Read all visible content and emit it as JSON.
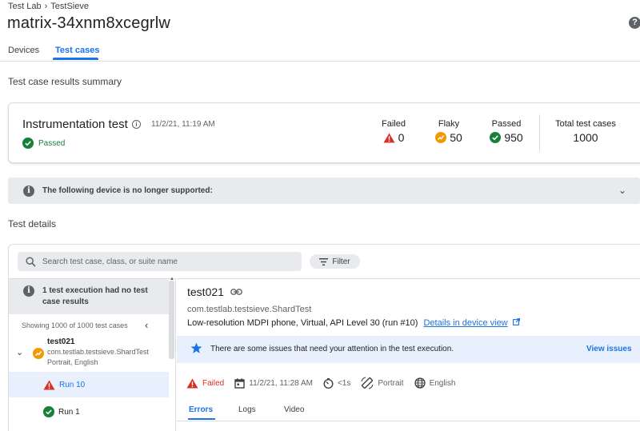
{
  "breadcrumb": {
    "root": "Test Lab",
    "separator": "›",
    "current": "TestSieve"
  },
  "page_title": "matrix-34xnm8xcegrlw",
  "help_icon": "help-circle-icon",
  "tabs": [
    {
      "label": "Devices",
      "active": false
    },
    {
      "label": "Test cases",
      "active": true
    }
  ],
  "summary": {
    "section_title": "Test case results summary",
    "test_name": "Instrumentation test",
    "datetime": "11/2/21, 11:19 AM",
    "status": "Passed",
    "stats": {
      "failed": {
        "label": "Failed",
        "value": "0",
        "icon": "warning-triangle-icon"
      },
      "flaky": {
        "label": "Flaky",
        "value": "50",
        "icon": "flaky-icon"
      },
      "passed": {
        "label": "Passed",
        "value": "950",
        "icon": "check-circle-icon"
      },
      "total": {
        "label": "Total test cases",
        "value": "1000"
      }
    }
  },
  "device_banner": {
    "text": "The following device is no longer supported:"
  },
  "details": {
    "section_title": "Test details",
    "search_placeholder": "Search test case, class, or suite name",
    "filter_label": "Filter",
    "left": {
      "notice": "1 test execution had no test case results",
      "showing": "Showing 1000 of 1000 test cases",
      "tree": {
        "name": "test021",
        "class": "com.testlab.testsieve.ShardTest",
        "config": "Portrait, English"
      },
      "runs": [
        {
          "label": "Run 10",
          "status": "failed",
          "selected": true
        },
        {
          "label": "Run 1",
          "status": "passed",
          "selected": false
        }
      ]
    },
    "right": {
      "title": "test021",
      "class": "com.testlab.testsieve.ShardTest",
      "device": "Low-resolution MDPI phone, Virtual, API Level 30 (run #10)",
      "device_link": "Details in device view",
      "issue_text": "There are some issues that need your attention in the test execution.",
      "view_issues": "View issues",
      "meta": {
        "status": "Failed",
        "datetime": "11/2/21, 11:28 AM",
        "duration": "<1s",
        "orientation": "Portrait",
        "locale": "English"
      },
      "tabs": [
        "Errors",
        "Logs",
        "Video"
      ]
    }
  },
  "colors": {
    "accent": "#1a73e8",
    "passed": "#188038",
    "failed": "#d93025",
    "flaky": "#f29900"
  }
}
